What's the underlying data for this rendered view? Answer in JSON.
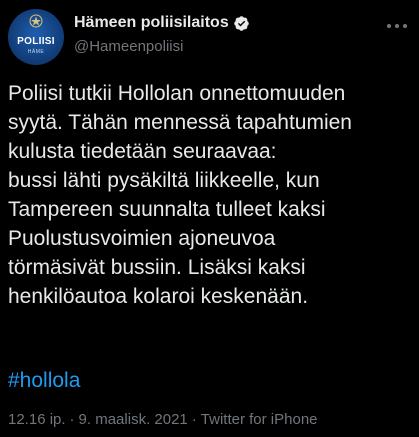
{
  "account": {
    "avatar_title": "POLIISI",
    "avatar_subtitle": "HÄME",
    "avatar_color": "#1a4f96",
    "display_name": "Hämeen poliisilaitos",
    "verified_icon": "verified-badge-icon",
    "handle": "@Hameenpoliisi"
  },
  "tweet": {
    "lines": [
      "Poliisi tutkii Hollolan onnettomuuden",
      "syytä. Tähän mennessä tapahtumien",
      "kulusta tiedetään seuraavaa:",
      "bussi lähti pysäkiltä liikkeelle, kun",
      "Tampereen suunnalta tulleet kaksi",
      "Puolustusvoimien ajoneuvoa",
      "törmäsivät bussiin. Lisäksi kaksi",
      "henkilöautoa kolaroi keskenään."
    ],
    "hashtag": "#hollola",
    "hashtag_color": "#1d9bf0"
  },
  "meta": {
    "time": "12.16 ip.",
    "separator": "·",
    "date": "9. maalisk. 2021",
    "source": "Twitter for iPhone"
  },
  "colors": {
    "background": "#000000",
    "text": "#e7e9ea",
    "muted": "#71767b"
  }
}
